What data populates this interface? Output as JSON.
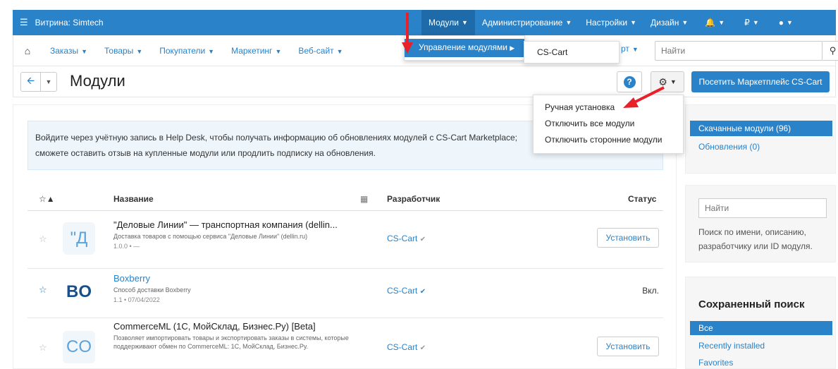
{
  "topbar": {
    "store_label": "Витрина: Simtech",
    "menu": [
      {
        "label": "Модули",
        "active": true
      },
      {
        "label": "Администрирование"
      },
      {
        "label": "Настройки"
      },
      {
        "label": "Дизайн"
      },
      {
        "label": ""
      },
      {
        "label": "₽"
      },
      {
        "label": ""
      }
    ]
  },
  "navbar": {
    "items": [
      "Заказы",
      "Товары",
      "Покупатели",
      "Маркетинг",
      "Веб-сайт"
    ],
    "reports_partial": "рт",
    "search_placeholder": "Найти"
  },
  "modules_dropdown": {
    "item": "Управление модулями",
    "submenu_item": "CS-Cart"
  },
  "titlebar": {
    "title": "Модули",
    "marketplace_button": "Посетить Маркетплейс CS-Cart"
  },
  "gear_menu": {
    "items": [
      "Ручная установка",
      "Отключить все модули",
      "Отключить сторонние модули"
    ]
  },
  "notice": {
    "line1": "Войдите через учётную запись в Help Desk, чтобы получать информацию об обновлениях модулей с CS-Cart Marketplace;",
    "line2": "сможете оставить отзыв на купленные модули или продлить подписку на обновления."
  },
  "table": {
    "headers": {
      "name": "Название",
      "developer": "Разработчик",
      "status": "Статус"
    },
    "rows": [
      {
        "logo": "\"Д",
        "name": "\"Деловые Линии\" — транспортная компания (dellin...",
        "desc": "Доставка товаров с помощью сервиса \"Деловые Линии\" (dellin.ru)",
        "version": "1.0.0 • —",
        "developer": "CS-Cart",
        "action": "Установить"
      },
      {
        "logo": "BO",
        "name": "Boxberry",
        "desc": "Способ доставки Boxberry",
        "version": "1.1 • 07/04/2022",
        "developer": "CS-Cart",
        "status": "Вкл."
      },
      {
        "logo": "CO",
        "name": "CommerceML (1С, МойСклад, Бизнес.Ру) [Beta]",
        "desc": "Позволяет импортировать товары и экспортировать заказы в системы, которые поддерживают обмен по CommerceML: 1С, МойСклад, Бизнес.Ру.",
        "version": "",
        "developer": "CS-Cart",
        "action": "Установить"
      }
    ]
  },
  "sidebar": {
    "filters": [
      {
        "label": "Скачанные модули (96)",
        "active": true
      },
      {
        "label": "Обновления (0)"
      }
    ],
    "search_placeholder": "Найти",
    "search_hint": "Поиск по имени, описанию, разработчику или ID модуля.",
    "saved_search_title": "Сохраненный поиск",
    "saved": [
      {
        "label": "Все",
        "active": true
      },
      {
        "label": "Recently installed"
      },
      {
        "label": "Favorites"
      }
    ]
  },
  "colors": {
    "accent": "#2a82c8",
    "arrow": "#e8202a"
  }
}
